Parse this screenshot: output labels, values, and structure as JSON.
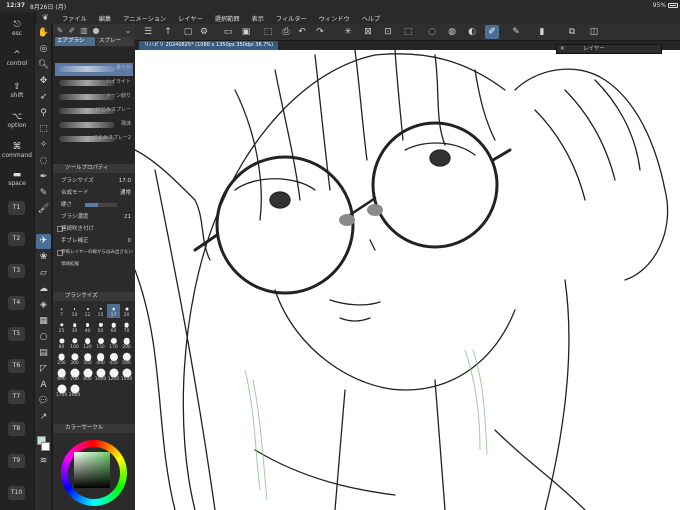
{
  "status": {
    "time": "12:37",
    "date": "8月26日 (月)",
    "battery": "95%"
  },
  "menu": {
    "items": [
      "ファイル",
      "編集",
      "アニメーション",
      "レイヤー",
      "選択範囲",
      "表示",
      "フィルター",
      "ウィンドウ",
      "ヘルプ"
    ]
  },
  "shortcuts": {
    "keys": [
      {
        "glyph": "⎋",
        "label": "esc"
      },
      {
        "glyph": "^",
        "label": "control"
      },
      {
        "glyph": "⇧",
        "label": "shift"
      },
      {
        "glyph": "⌥",
        "label": "option"
      },
      {
        "glyph": "⌘",
        "label": "command"
      },
      {
        "glyph": "▬",
        "label": "space"
      }
    ],
    "touch_keys": [
      "T1",
      "T2",
      "T3",
      "T4",
      "T5",
      "T6",
      "T7",
      "T8",
      "T9",
      "T10"
    ]
  },
  "subtool": {
    "tabs": [
      "エアブラシ",
      "スプレー"
    ],
    "brushes": [
      "柔らか",
      "ハイライト",
      "トーン削り",
      "にじみスプレー",
      "飛沫",
      "にじみスプレー2"
    ]
  },
  "tool_property": {
    "title": "ツールプロパティ",
    "brush_size_label": "ブラシサイズ",
    "brush_size_value": "17.0",
    "blend_label": "合成モード",
    "blend_value": "通常",
    "hardness_label": "硬さ",
    "density_label": "ブラシ濃度",
    "density_value": "21",
    "continuous_label": "連続吹き付け",
    "stabilizer_label": "手ブレ補正",
    "stabilizer_value": "0",
    "ref_label": "参照レイヤーの線からはみ出さない",
    "area_label": "領域拡縮"
  },
  "brush_size_panel": {
    "title": "ブラシサイズ",
    "sizes": [
      "7",
      "10",
      "12",
      "15",
      "17",
      "20",
      "25",
      "30",
      "40",
      "50",
      "60",
      "70",
      "80",
      "100",
      "120",
      "150",
      "170",
      "200",
      "250",
      "300",
      "350",
      "400",
      "450",
      "500",
      "600",
      "700",
      "800",
      "1000",
      "1200",
      "1500",
      "1700",
      "2000"
    ],
    "selected": "17"
  },
  "color_circle": {
    "title": "カラーサークル",
    "bottom_values": [
      "17",
      "75",
      "87"
    ]
  },
  "canvas": {
    "tab_title": "リハビリ 20240825* (1080 x 1350px 350dpi 36.7%)"
  },
  "layer_popup": {
    "title": "レイヤー"
  }
}
